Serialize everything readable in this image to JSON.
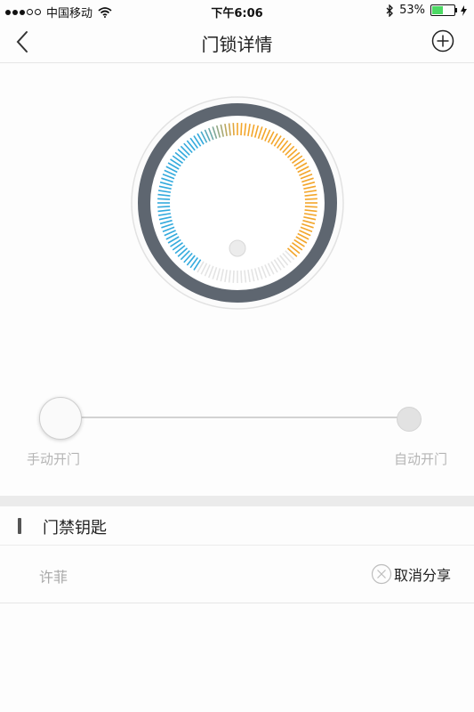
{
  "status_bar": {
    "carrier": "中国移动",
    "time": "下午6:06",
    "battery": "53%",
    "battery_level": 0.53,
    "icons": [
      "signal-dots-icon",
      "wifi-icon",
      "bluetooth-icon",
      "battery-icon",
      "charging-icon"
    ]
  },
  "navbar": {
    "title": "门锁详情",
    "back_icon": "chevron-left-icon",
    "add_icon": "plus-circle-icon"
  },
  "dial": {
    "colors": {
      "outer_ring": "#5e6670",
      "blue": "#33aadd",
      "orange": "#f3a62b",
      "inactive": "#e4e4e4"
    }
  },
  "mode_slider": {
    "left_label": "手动开门",
    "right_label": "自动开门",
    "selected": "手动开门"
  },
  "access_keys": {
    "section_title": "门禁钥匙",
    "items": [
      {
        "name": "许菲",
        "action_label": "取消分享",
        "action_icon": "close-circle-icon"
      }
    ]
  }
}
